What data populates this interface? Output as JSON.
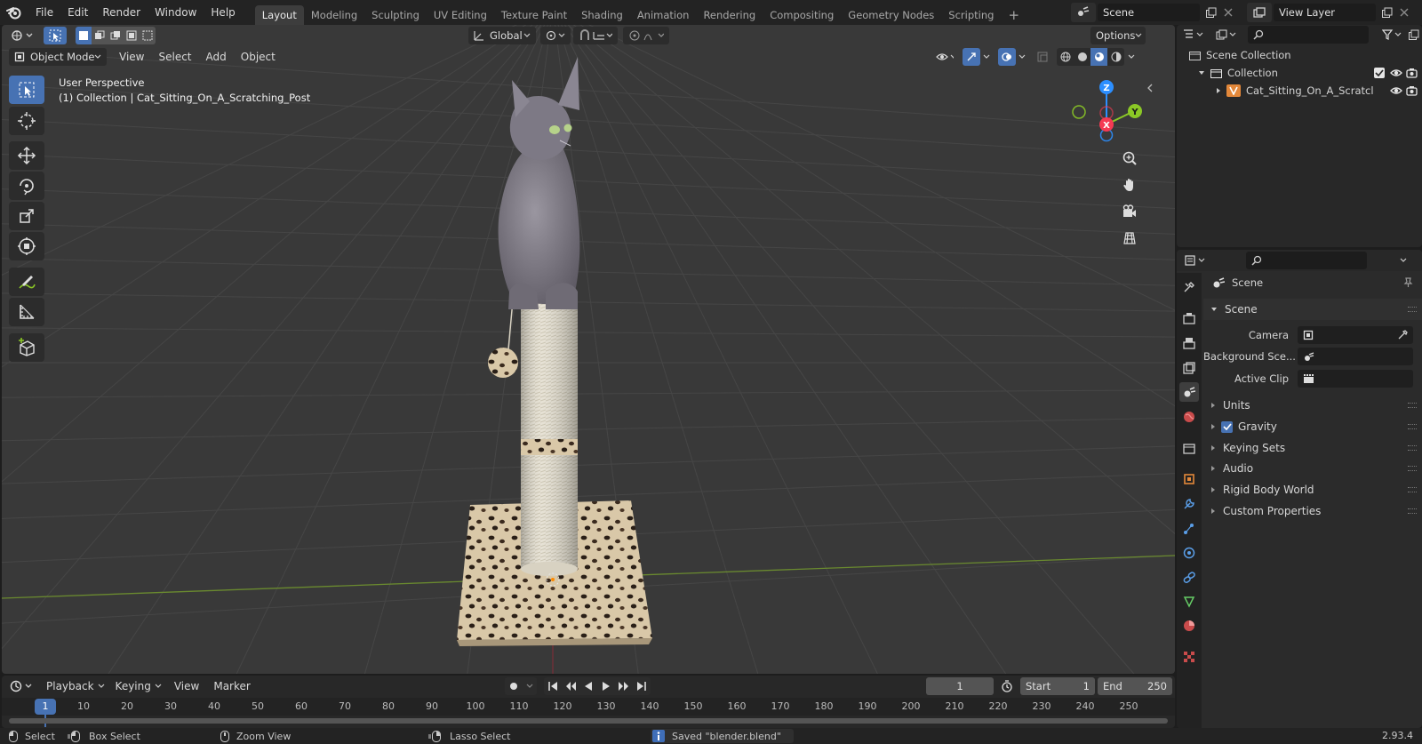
{
  "topbar": {
    "menus": [
      "File",
      "Edit",
      "Render",
      "Window",
      "Help"
    ],
    "workspaces": [
      "Layout",
      "Modeling",
      "Sculpting",
      "UV Editing",
      "Texture Paint",
      "Shading",
      "Animation",
      "Rendering",
      "Compositing",
      "Geometry Nodes",
      "Scripting"
    ],
    "active_workspace": "Layout",
    "add_tab": "+",
    "scene": "Scene",
    "view_layer": "View Layer"
  },
  "viewport_header": {
    "transform_orientation": "Global",
    "options_label": "Options",
    "mode": "Object Mode",
    "menus": [
      "View",
      "Select",
      "Add",
      "Object"
    ]
  },
  "viewport": {
    "view_name": "User Perspective",
    "collection_info": "(1) Collection | Cat_Sitting_On_A_Scratching_Post",
    "gizmo": {
      "x": "X",
      "y": "Y",
      "z": "Z"
    }
  },
  "outliner": {
    "scene_collection": "Scene Collection",
    "collection": "Collection",
    "object": "Cat_Sitting_On_A_Scratcl"
  },
  "properties": {
    "context": "Scene",
    "panel_title": "Scene",
    "fields": [
      {
        "label": "Camera",
        "value": ""
      },
      {
        "label": "Background Sce...",
        "value": ""
      },
      {
        "label": "Active Clip",
        "value": ""
      }
    ],
    "subpanels": [
      "Units",
      "Gravity",
      "Keying Sets",
      "Audio",
      "Rigid Body World",
      "Custom Properties"
    ],
    "gravity_enabled": true
  },
  "timeline": {
    "menus": [
      "Playback",
      "Keying",
      "View",
      "Marker"
    ],
    "current_frame": "1",
    "start_label": "Start",
    "start": "1",
    "end_label": "End",
    "end": "250",
    "ruler": [
      "1",
      "10",
      "20",
      "30",
      "40",
      "50",
      "60",
      "70",
      "80",
      "90",
      "100",
      "110",
      "120",
      "130",
      "140",
      "150",
      "160",
      "170",
      "180",
      "190",
      "200",
      "210",
      "220",
      "230",
      "240",
      "250"
    ]
  },
  "statusbar": {
    "select": "Select",
    "box_select": "Box Select",
    "zoom_view": "Zoom View",
    "lasso_select": "Lasso Select",
    "message": "Saved \"blender.blend\"",
    "version": "2.93.4"
  },
  "colors": {
    "accent": "#4772b3",
    "x_axis": "#f53a53",
    "y_axis": "#8bc826",
    "z_axis": "#2c8fff",
    "background": "#393939"
  }
}
